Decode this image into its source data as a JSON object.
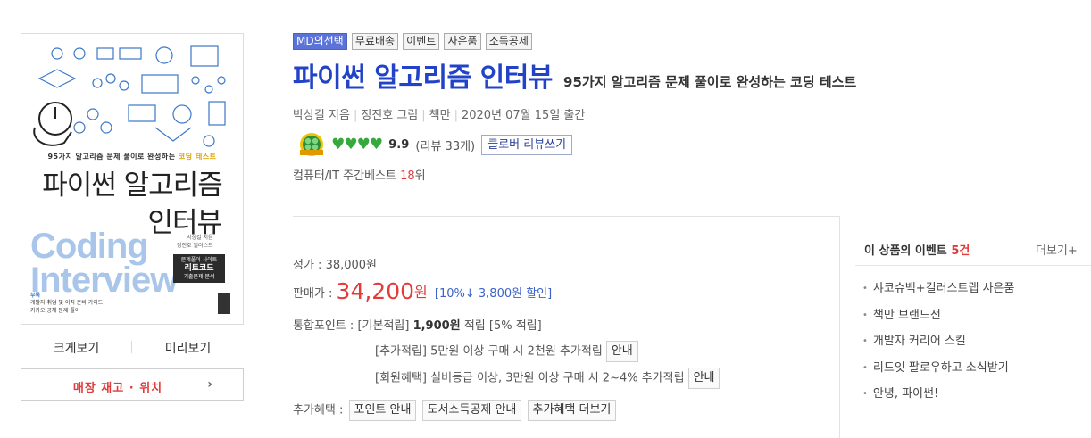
{
  "cover": {
    "subtitle_prefix": "95가지 알고리즘 문제 풀이로 완성하는",
    "subtitle_highlight": "코딩 테스트",
    "title_line1": "파이썬 알고리즘",
    "title_line2": "인터뷰",
    "english_line1": "Coding",
    "english_line2": "Interview",
    "authors_line1": "박상길 지음",
    "authors_line2": "정진호 일러스트",
    "badge_top": "문제풀이 사이트",
    "badge_main": "리트코드",
    "badge_bottom": "기출문제 분석",
    "footer_tag": "부록",
    "footer_line1": "개발자 취업 및 이직 준비 가이드",
    "footer_line2": "카카오 공채 문제 풀이"
  },
  "view_links": {
    "large": "크게보기",
    "preview": "미리보기"
  },
  "store_button": {
    "label": "매장 재고 · 위치",
    "chevron": "›"
  },
  "badges": [
    "MD의선택",
    "무료배송",
    "이벤트",
    "사은품",
    "소득공제"
  ],
  "product": {
    "title": "파이썬 알고리즘 인터뷰",
    "subtitle": "95가지 알고리즘 문제 풀이로 완성하는 코딩 테스트",
    "author": "박상길 지음",
    "illustrator": "정진호 그림",
    "publisher": "책만",
    "pub_date": "2020년 07월 15일 출간"
  },
  "rating": {
    "hearts": "♥♥♥♥",
    "score": "9.9",
    "reviews": "(리뷰 33개)",
    "review_button": "클로버 리뷰쓰기"
  },
  "bestseller": {
    "label": "컴퓨터/IT 주간베스트",
    "rank": "18",
    "rank_suffix": "위"
  },
  "price": {
    "list_label": "정가 : 38,000원",
    "sale_label": "판매가 :",
    "sale_value": "34,200",
    "sale_unit": "원",
    "discount": "[10%↓ 3,800원 할인]"
  },
  "points": {
    "label": "통합포인트 : ",
    "base_tag": "[기본적립]",
    "base_amount": "1,900원",
    "base_suffix": "적립",
    "base_rate": "[5% 적립]",
    "extra_text": "[추가적립] 5만원 이상 구매 시 2천원 추가적립",
    "member_text": "[회원혜택] 실버등급 이상, 3만원 이상 구매 시 2~4% 추가적립",
    "info_button": "안내"
  },
  "benefits": {
    "label": "추가혜택 : ",
    "buttons": [
      "포인트 안내",
      "도서소득공제 안내",
      "추가혜택 더보기"
    ]
  },
  "events": {
    "title_prefix": "이 상품의 이벤트",
    "count": "5건",
    "more": "더보기+",
    "bullet": "•",
    "items": [
      "샤코슈백+컬러스트랩 사은품",
      "책만 브랜드전",
      "개발자 커리어 스킬",
      "리드잇 팔로우하고 소식받기",
      "안녕, 파이썬!"
    ]
  },
  "colors": {
    "title_blue": "#2243c8",
    "price_red": "#e53a3a",
    "md_badge": "#5b73d9",
    "heart_green": "#36a93c"
  }
}
